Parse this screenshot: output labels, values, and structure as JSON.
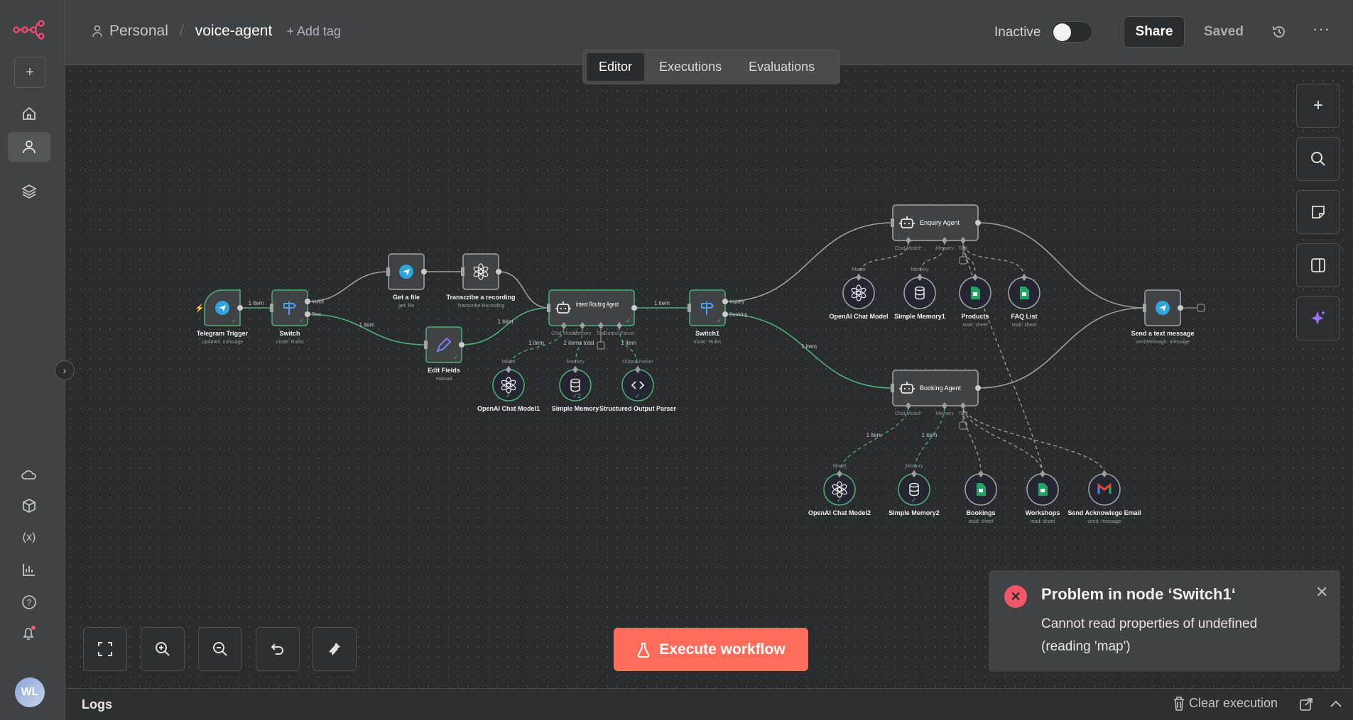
{
  "app": {
    "brand_color": "#ea4b71",
    "accent": "#ff6d5a"
  },
  "sidebar": {
    "items": [
      {
        "id": "add",
        "icon": "plus-icon"
      },
      {
        "id": "overview",
        "icon": "home-icon"
      },
      {
        "id": "personal",
        "icon": "user-icon",
        "active": true
      },
      {
        "id": "projects",
        "icon": "layers-icon"
      },
      {
        "id": "cloud",
        "icon": "cloud-icon"
      },
      {
        "id": "templates",
        "icon": "box-icon"
      },
      {
        "id": "variables",
        "icon": "variables-icon"
      },
      {
        "id": "insights",
        "icon": "chart-icon"
      },
      {
        "id": "help",
        "icon": "help-icon"
      },
      {
        "id": "notifications",
        "icon": "bell-icon"
      }
    ],
    "avatar": "WL"
  },
  "header": {
    "project": "Personal",
    "separator": "/",
    "workflow_name": "voice-agent",
    "add_tag": "+ Add tag",
    "status": "Inactive",
    "active": false,
    "share": "Share",
    "saved": "Saved"
  },
  "tabs": [
    {
      "label": "Editor",
      "active": true
    },
    {
      "label": "Executions"
    },
    {
      "label": "Evaluations"
    }
  ],
  "workflow": {
    "nodes": [
      {
        "id": "trigger",
        "name": "Telegram Trigger",
        "sub": "Updates: message",
        "icon": "telegram"
      },
      {
        "id": "switch",
        "name": "Switch",
        "sub": "mode: Rules",
        "icon": "switch",
        "outputs": [
          "Voice",
          "Text"
        ]
      },
      {
        "id": "getfile",
        "name": "Get a file",
        "sub": "get: file",
        "icon": "telegram"
      },
      {
        "id": "transcribe",
        "name": "Transcribe a recording",
        "sub": "Transcribe Recording",
        "icon": "openai"
      },
      {
        "id": "edit",
        "name": "Edit Fields",
        "sub": "manual",
        "icon": "pencil"
      },
      {
        "id": "intent",
        "name": "Intent Routing Agent",
        "sub": "",
        "icon": "robot",
        "inputs": [
          "Chat Model",
          "Memory",
          "Tool",
          "Output Parser"
        ]
      },
      {
        "id": "om1",
        "name": "OpenAI Chat Model1",
        "sub": "",
        "icon": "openai",
        "port": "Model"
      },
      {
        "id": "sm",
        "name": "Simple Memory",
        "sub": "",
        "icon": "database",
        "port": "Memory",
        "badge": "2"
      },
      {
        "id": "sop",
        "name": "Structured Output Parser",
        "sub": "",
        "icon": "code",
        "port": "Output Parser"
      },
      {
        "id": "switch1",
        "name": "Switch1",
        "sub": "mode: Rules",
        "icon": "switch",
        "outputs": [
          "Inquiry",
          "Booking"
        ]
      },
      {
        "id": "enquiry",
        "name": "Enquiry Agent",
        "sub": "",
        "icon": "robot",
        "inputs": [
          "Chat Model*",
          "Memory",
          "Tool"
        ]
      },
      {
        "id": "booking",
        "name": "Booking Agent",
        "sub": "",
        "icon": "robot",
        "inputs": [
          "Chat Model*",
          "Memory",
          "Tool"
        ]
      },
      {
        "id": "ocm",
        "name": "OpenAI Chat Model",
        "sub": "",
        "icon": "openai",
        "port": "Model"
      },
      {
        "id": "sm1",
        "name": "Simple Memory1",
        "sub": "",
        "icon": "database",
        "port": "Memory"
      },
      {
        "id": "products",
        "name": "Products",
        "sub": "read: sheet",
        "icon": "sheets"
      },
      {
        "id": "faq",
        "name": "FAQ List",
        "sub": "read: sheet",
        "icon": "sheets"
      },
      {
        "id": "send",
        "name": "Send a text message",
        "sub": "sendMessage: message",
        "icon": "telegram"
      },
      {
        "id": "ocm2",
        "name": "OpenAI Chat Model2",
        "sub": "",
        "icon": "openai",
        "port": "Model"
      },
      {
        "id": "sm2",
        "name": "Simple Memory2",
        "sub": "",
        "icon": "database",
        "port": "Memory"
      },
      {
        "id": "bookings",
        "name": "Bookings",
        "sub": "read: sheet",
        "icon": "sheets"
      },
      {
        "id": "workshops",
        "name": "Workshops",
        "sub": "read: sheet",
        "icon": "sheets"
      },
      {
        "id": "email",
        "name": "Send Acknowlege Email",
        "sub": "send: message",
        "icon": "gmail"
      }
    ],
    "connections": [
      {
        "from": "trigger",
        "to": "switch",
        "label": "1 item",
        "ok": true
      },
      {
        "from": "switch",
        "out": 0,
        "to": "getfile",
        "label": "",
        "ok": false
      },
      {
        "from": "switch",
        "out": 1,
        "to": "edit",
        "label": "1 item",
        "ok": true
      },
      {
        "from": "getfile",
        "to": "transcribe",
        "label": "",
        "ok": false
      },
      {
        "from": "transcribe",
        "to": "intent",
        "label": "",
        "ok": false
      },
      {
        "from": "edit",
        "to": "intent",
        "label": "1 item",
        "ok": true
      },
      {
        "from": "intent",
        "to": "switch1",
        "label": "1 item",
        "ok": true
      },
      {
        "from": "switch1",
        "out": 0,
        "to": "enquiry",
        "label": "",
        "ok": false
      },
      {
        "from": "switch1",
        "out": 1,
        "to": "booking",
        "label": "1 item",
        "ok": true
      },
      {
        "from": "enquiry",
        "to": "send",
        "label": "",
        "ok": false
      },
      {
        "from": "booking",
        "to": "send",
        "label": "",
        "ok": false
      },
      {
        "from": "om1",
        "to": "intent",
        "in": 0,
        "label": "1 item",
        "ok": true,
        "sub": true
      },
      {
        "from": "sm",
        "to": "intent",
        "in": 1,
        "label": "2 items total",
        "ok": true,
        "sub": true
      },
      {
        "from": "sop",
        "to": "intent",
        "in": 3,
        "label": "1 item",
        "ok": true,
        "sub": true
      },
      {
        "from": "ocm",
        "to": "enquiry",
        "in": 0,
        "label": "",
        "ok": false,
        "sub": true
      },
      {
        "from": "sm1",
        "to": "enquiry",
        "in": 1,
        "label": "",
        "ok": false,
        "sub": true
      },
      {
        "from": "products",
        "to": "enquiry",
        "in": 2,
        "label": "",
        "ok": false,
        "sub": true
      },
      {
        "from": "faq",
        "to": "enquiry",
        "in": 2,
        "label": "",
        "ok": false,
        "sub": true
      },
      {
        "from": "workshops",
        "to": "enquiry",
        "in": 2,
        "label": "",
        "ok": false,
        "sub": true
      },
      {
        "from": "ocm2",
        "to": "booking",
        "in": 0,
        "label": "1 item",
        "ok": true,
        "sub": true
      },
      {
        "from": "sm2",
        "to": "booking",
        "in": 1,
        "label": "1 item",
        "ok": true,
        "sub": true
      },
      {
        "from": "bookings",
        "to": "booking",
        "in": 2,
        "label": "",
        "ok": false,
        "sub": true
      },
      {
        "from": "workshops",
        "to": "booking",
        "in": 2,
        "label": "",
        "ok": false,
        "sub": true
      },
      {
        "from": "email",
        "to": "booking",
        "in": 2,
        "label": "",
        "ok": false,
        "sub": true
      }
    ]
  },
  "canvas_controls": [
    {
      "icon": "plus-icon"
    },
    {
      "icon": "search-icon"
    },
    {
      "icon": "sticky-note-icon"
    },
    {
      "icon": "panel-icon"
    },
    {
      "icon": "sparkle-icon"
    }
  ],
  "bottom_controls": [
    {
      "icon": "fit-view-icon"
    },
    {
      "icon": "zoom-in-icon"
    },
    {
      "icon": "zoom-out-icon"
    },
    {
      "icon": "undo-icon"
    },
    {
      "icon": "clear-icon"
    }
  ],
  "execute": {
    "label": "Execute workflow"
  },
  "toast": {
    "title": "Problem in node ‘Switch1‘",
    "message": "Cannot read properties of undefined (reading 'map')",
    "error_color": "#f2566b"
  },
  "logs": {
    "label": "Logs",
    "clear": "Clear execution"
  }
}
